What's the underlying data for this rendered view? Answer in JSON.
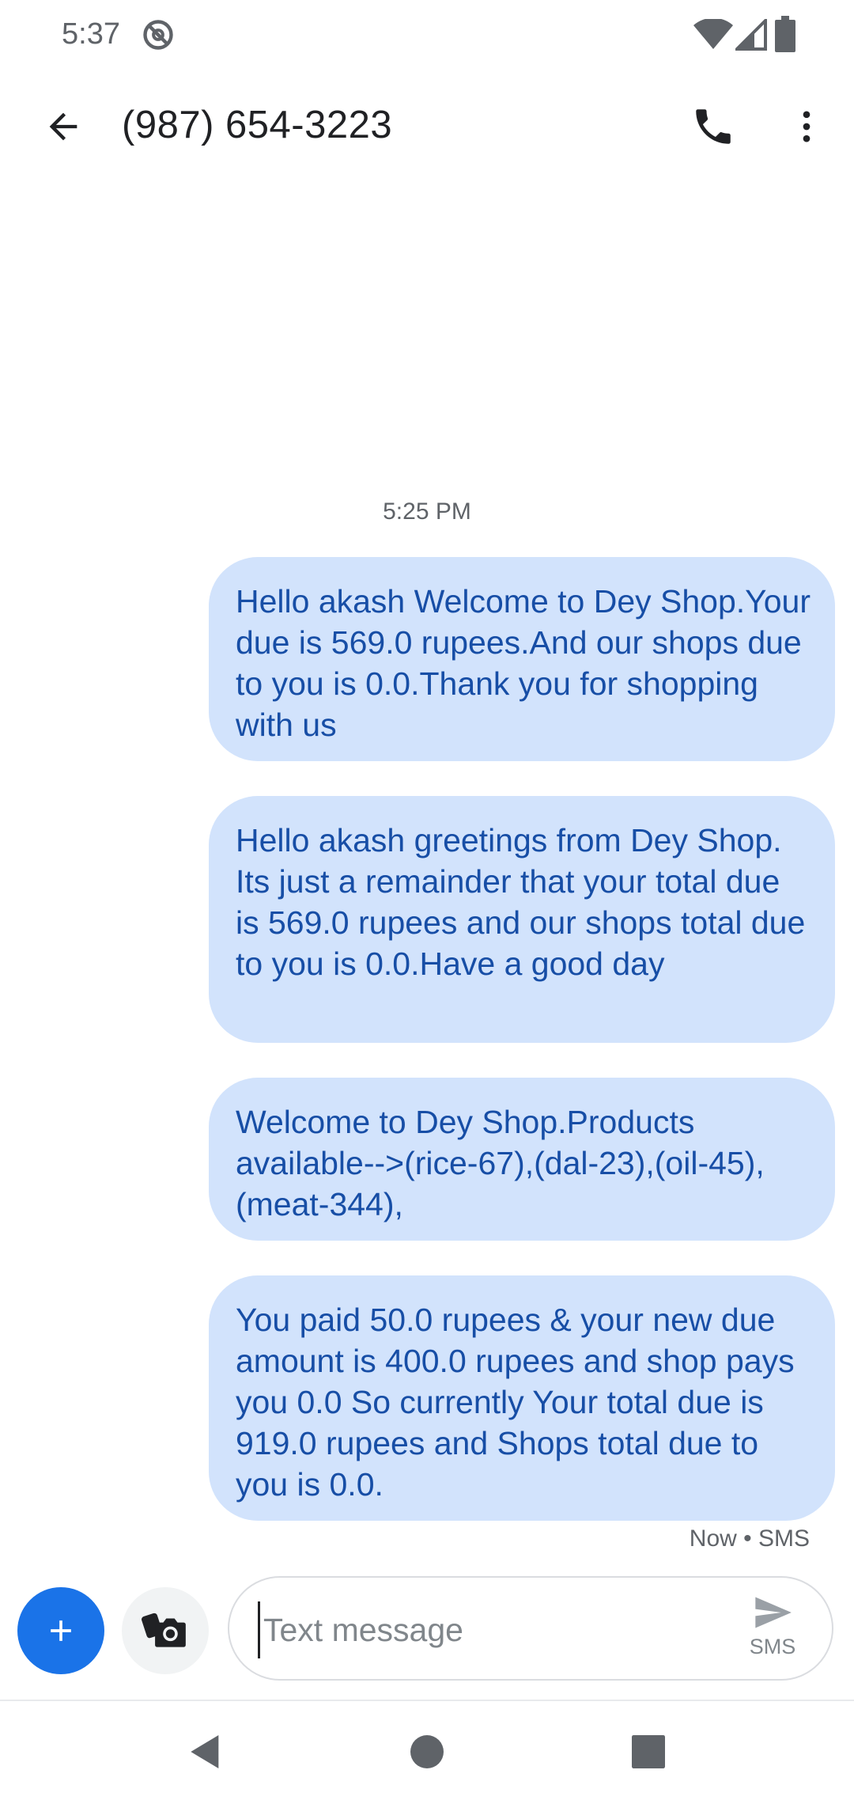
{
  "status_bar": {
    "time": "5:37"
  },
  "app_bar": {
    "title": "(987) 654-3223"
  },
  "thread": {
    "timestamp": "5:25 PM",
    "messages": [
      {
        "text": "Hello akash Welcome to Dey Shop.Your due is 569.0 rupees.And our shops due to you is 0.0.Thank you for shopping with us"
      },
      {
        "text": "Hello akash greetings from Dey Shop. Its just a remainder that your total due is 569.0 rupees and our shops total due to you is 0.0.Have a good day"
      },
      {
        "text": "Welcome to Dey Shop.Products available-->(rice-67),(dal-23),(oil-45),(meat-344),"
      },
      {
        "text": "You paid 50.0 rupees & your new due amount is 400.0 rupees and shop pays you 0.0 So currently Your total due is 919.0 rupees and Shops total due to you is 0.0."
      }
    ],
    "last_status": "Now • SMS"
  },
  "compose": {
    "placeholder": "Text message",
    "send_label": "SMS"
  },
  "colors": {
    "accent": "#1a73e8",
    "bubble_bg": "#d2e3fc",
    "bubble_text": "#174ea6"
  },
  "icons": [
    "dnd-icon",
    "wifi-icon",
    "signal-icon",
    "battery-icon",
    "back-arrow-icon",
    "phone-icon",
    "more-vert-icon",
    "plus-icon",
    "camera-icon",
    "send-icon",
    "nav-back-icon",
    "nav-home-icon",
    "nav-recents-icon"
  ]
}
